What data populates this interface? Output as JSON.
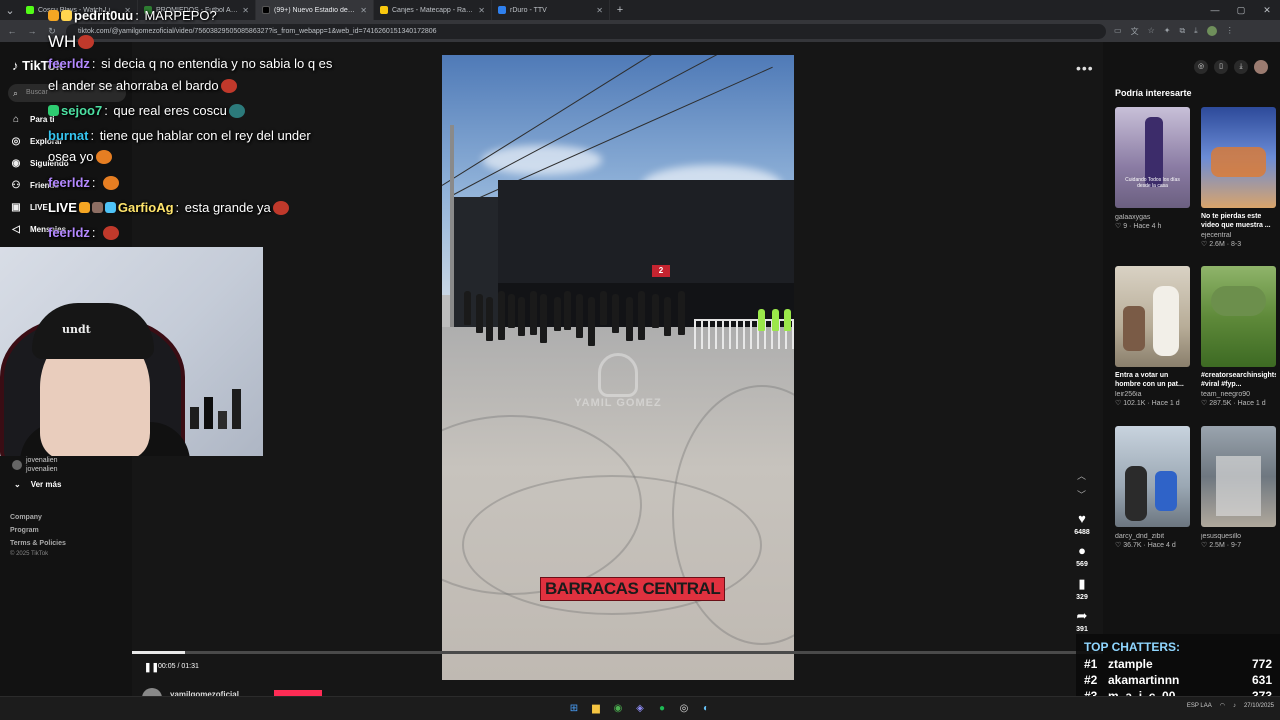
{
  "browser": {
    "tabs": [
      {
        "title": "Coscu Plays - Watch Live on Ki",
        "fav": "#53fc18",
        "active": false
      },
      {
        "title": "PROMIEDOS - Futbol Argentino",
        "fav": "#2e7d32",
        "active": false
      },
      {
        "title": "(99+) Nuevo Estadio de Fútbol",
        "fav": "#000000",
        "active": true
      },
      {
        "title": "Canjes - Matecapp - Ranking y",
        "fav": "#f9c80e",
        "active": false
      },
      {
        "title": "rDuro - TTV",
        "fav": "#2f80ed",
        "active": false
      }
    ],
    "url": "tiktok.com/@yamilgomezoficial/video/7560382950508586327?is_from_webapp=1&web_id=7416260151340172806"
  },
  "tiktok": {
    "logo": "TikTok",
    "search_placeholder": "Buscar",
    "nav": [
      "Para ti",
      "Explorar",
      "Siguiendo",
      "Friends",
      "LIVE",
      "Mensajes"
    ],
    "following_user": "jovenalien",
    "following_handle": "jovenalien",
    "ver_mas": "Ver más",
    "footer_links": [
      "Company",
      "Program",
      "Terms & Policies"
    ],
    "copyright": "© 2025 TikTok",
    "video": {
      "caption": "BARRACAS CENTRAL",
      "watermark": "YAMIL GOMEZ",
      "sign": "2",
      "time": "00:05 / 01:31",
      "progress": 0.055,
      "author": "yamilgomezoficial"
    },
    "actions": [
      {
        "name": "like",
        "icon": "♥",
        "count": "6488"
      },
      {
        "name": "comment",
        "icon": "●",
        "count": "569"
      },
      {
        "name": "save",
        "icon": "▮",
        "count": "329"
      },
      {
        "name": "share",
        "icon": "➦",
        "count": "391"
      }
    ],
    "sidebar_title": "Podría interesarte",
    "recommended": [
      {
        "desc": "",
        "user": "galaaxygas",
        "stats": "♡ 9 · Hace 4 h",
        "thumb_text": "Cuidando Todos los días desde la casa"
      },
      {
        "desc": "No te pierdas este video que muestra ...",
        "user": "ejecentral",
        "stats": "♡ 2.6M · 8-3",
        "thumb_text": ""
      },
      {
        "desc": "Entra a votar un hombre con un pat...",
        "user": "leir256ia",
        "stats": "♡ 102.1K · Hace 1 d",
        "thumb_text": ""
      },
      {
        "desc": "#creatorsearchinsights #viral #fyp...",
        "user": "team_neegro90",
        "stats": "♡ 287.5K · Hace 1 d",
        "thumb_text": ""
      },
      {
        "desc": "",
        "user": "darcy_dnd_zibit",
        "stats": "♡ 36.7K · Hace 4 d",
        "thumb_text": ""
      },
      {
        "desc": "",
        "user": "jesusquesillo",
        "stats": "♡ 2.5M · 9-7",
        "thumb_text": ""
      }
    ]
  },
  "stream": {
    "chat": [
      {
        "user": "pedrit0uu",
        "text": "MARPEPO?",
        "color": "#ffffff"
      },
      {
        "user": "",
        "text": "WH",
        "color": "#ffffff"
      },
      {
        "user": "feerldz",
        "text": "si decia q no entendia y no sabia lo q es",
        "color": "#b388ff"
      },
      {
        "user": "",
        "text": "el ander se ahorraba el bardo",
        "color": "#ffffff"
      },
      {
        "user": "sejoo7",
        "text": "que real eres coscu",
        "color": "#4ce0a2"
      },
      {
        "user": "burnat",
        "text": "tiene que hablar con el rey del under",
        "color": "#36c5f0"
      },
      {
        "user": "",
        "text": "osea yo",
        "color": "#ffffff"
      },
      {
        "user": "feerldz",
        "text": "",
        "color": "#b388ff"
      },
      {
        "user": "GarfioAg",
        "text": "esta grande ya",
        "color": "#ffe46b"
      },
      {
        "user": "feerldz",
        "text": "",
        "color": "#b388ff"
      }
    ],
    "beanie_text": "undt",
    "top_chatters_title": "TOP CHATTERS:",
    "top_chatters": [
      {
        "rank": "#1",
        "name": "ztample",
        "count": "772"
      },
      {
        "rank": "#2",
        "name": "akamartinnn",
        "count": "631"
      },
      {
        "rank": "#3",
        "name": "m_a_i_c_00",
        "count": "373"
      }
    ]
  },
  "taskbar": {
    "icons": [
      "windows-icon",
      "folder-icon",
      "chrome-icon",
      "discord-icon",
      "spotify-icon",
      "obs-icon",
      "steam-icon"
    ],
    "tray_lang": "ESP LAA",
    "date": "27/10/2025"
  }
}
